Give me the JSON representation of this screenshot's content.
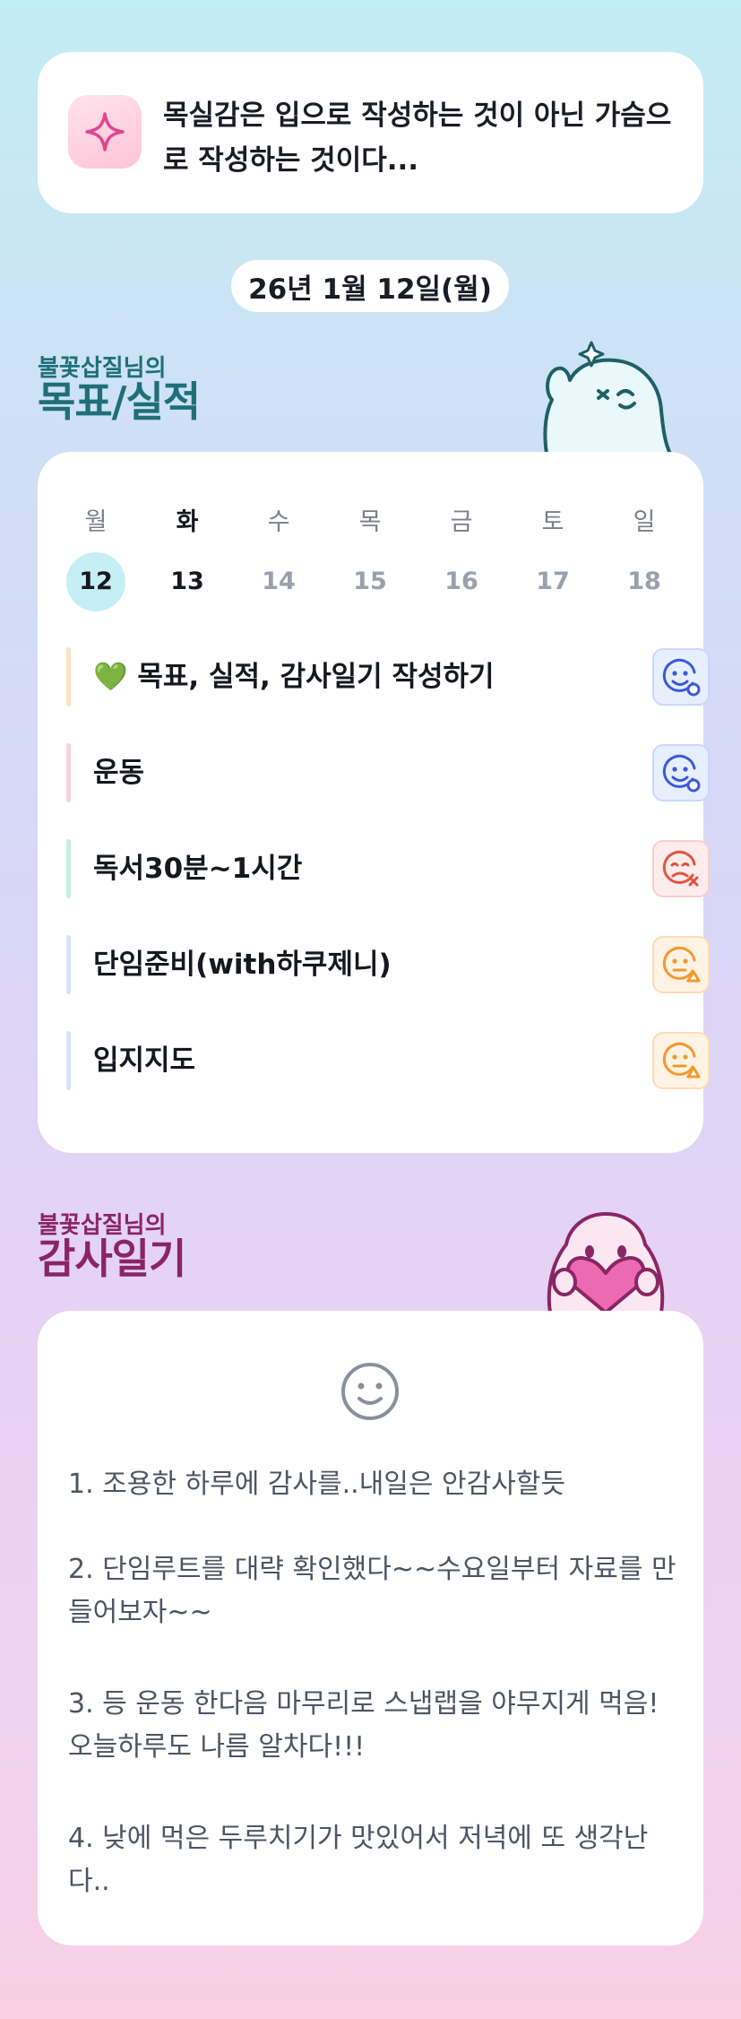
{
  "quote": {
    "icon": "sparkle-icon",
    "text": "목실감은 입으로 작성하는 것이 아닌 가슴으로 작성하는 것이다..."
  },
  "date": "26년 1월 12일(월)",
  "goals_section": {
    "owner": "불꽃삽질님의",
    "title": "목표/실적"
  },
  "week": {
    "days": [
      "월",
      "화",
      "수",
      "목",
      "금",
      "토",
      "일"
    ],
    "dates": [
      "12",
      "13",
      "14",
      "15",
      "16",
      "17",
      "18"
    ],
    "selected_index": 0
  },
  "goals": [
    {
      "label": "💚 목표, 실적, 감사일기 작성하기",
      "bar_color": "#fde2bf",
      "status": "good",
      "status_icon": "smile-face-icon"
    },
    {
      "label": "운동",
      "bar_color": "#fbd0e2",
      "status": "good",
      "status_icon": "smile-face-icon"
    },
    {
      "label": "독서30분~1시간",
      "bar_color": "#c6efe0",
      "status": "bad",
      "status_icon": "sad-face-icon"
    },
    {
      "label": "단임준비(with하쿠제니)",
      "bar_color": "#d6e3f8",
      "status": "partial",
      "status_icon": "meh-face-icon"
    },
    {
      "label": "입지지도",
      "bar_color": "#d6e3f8",
      "status": "partial",
      "status_icon": "meh-face-icon"
    }
  ],
  "gratitude_section": {
    "owner": "불꽃삽질님의",
    "title": "감사일기",
    "mood_icon": "smile-face-icon"
  },
  "gratitude": [
    "1. 조용한 하루에 감사를..내일은 안감사할듯",
    "2. 단임루트를 대략 확인했다~~수요일부터 자료를 만들어보자~~",
    "3. 등 운동 한다음 마무리로 스냅랩을 야무지게 먹음!오늘하루도 나름 알차다!!!",
    "4. 낮에 먹은 두루치기가 맛있어서 저녁에 또 생각난다.."
  ],
  "colors": {
    "goals_title": "#1f6f78",
    "gratitude_title": "#8a2563",
    "selected_day": "#c6eef5",
    "good": "#3a5bd9",
    "bad": "#e0533f",
    "partial": "#f29a2e"
  }
}
